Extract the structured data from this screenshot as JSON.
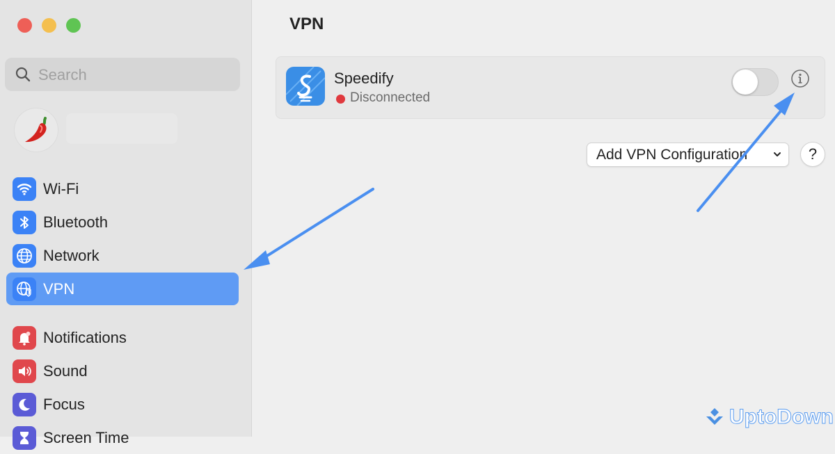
{
  "window": {
    "title": "VPN"
  },
  "sidebar": {
    "search_placeholder": "Search",
    "items": [
      {
        "label": "Wi-Fi",
        "icon": "wifi-icon",
        "color": "#3b82f6"
      },
      {
        "label": "Bluetooth",
        "icon": "bluetooth-icon",
        "color": "#3b82f6"
      },
      {
        "label": "Network",
        "icon": "globe-icon",
        "color": "#3b82f6"
      },
      {
        "label": "VPN",
        "icon": "vpn-globe-shield-icon",
        "color": "#3b82f6",
        "selected": true
      },
      {
        "label": "Notifications",
        "icon": "bell-icon",
        "color": "#e0474c"
      },
      {
        "label": "Sound",
        "icon": "speaker-icon",
        "color": "#e0474c"
      },
      {
        "label": "Focus",
        "icon": "moon-icon",
        "color": "#5b5bd6"
      },
      {
        "label": "Screen Time",
        "icon": "hourglass-icon",
        "color": "#5b5bd6"
      }
    ]
  },
  "main": {
    "title": "VPN",
    "vpn_service": {
      "name": "Speedify",
      "status": "Disconnected",
      "status_color": "#e0393e",
      "enabled": false
    },
    "add_button_label": "Add VPN Configuration",
    "help_label": "?"
  },
  "watermark": {
    "text": "UptoDown"
  },
  "colors": {
    "accent": "#5f9bf4",
    "annotation_arrow": "#4a8ff0"
  }
}
